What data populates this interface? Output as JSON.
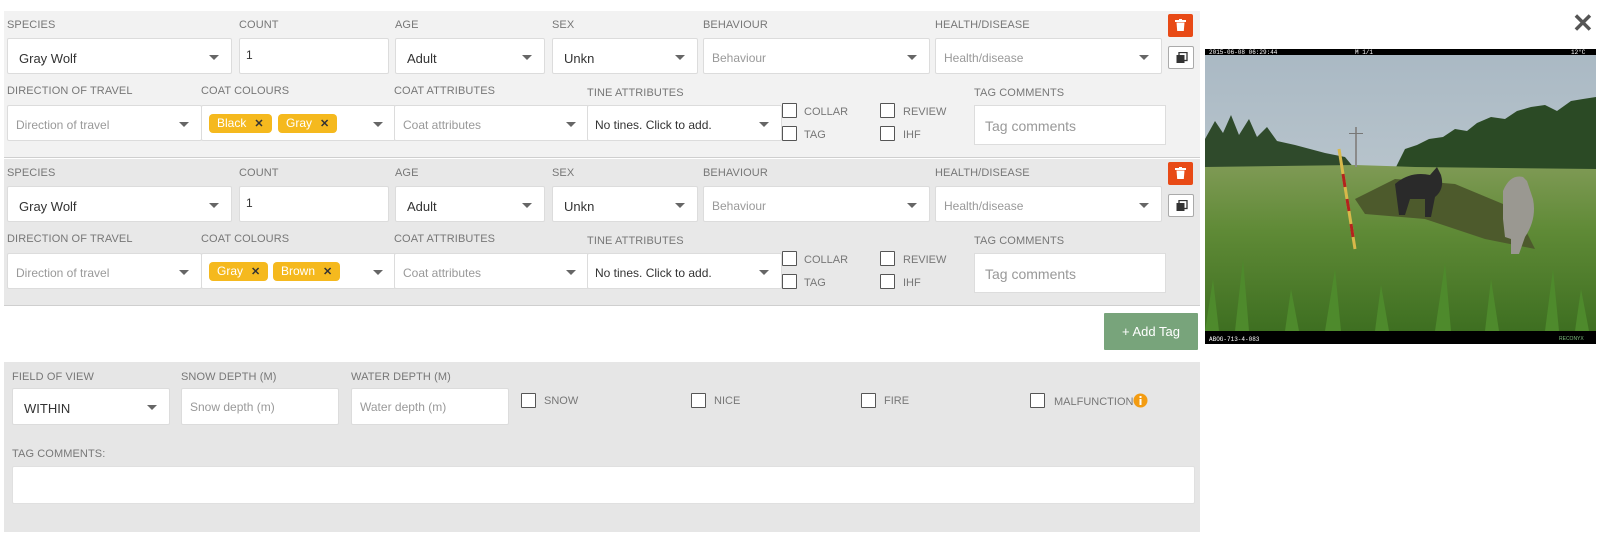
{
  "labels": {
    "species": "SPECIES",
    "count": "COUNT",
    "age": "AGE",
    "sex": "SEX",
    "behaviour": "BEHAVIOUR",
    "health": "HEALTH/DISEASE",
    "direction": "DIRECTION OF TRAVEL",
    "coat_colours": "COAT COLOURS",
    "coat_attributes": "COAT ATTRIBUTES",
    "tine_attributes": "TINE ATTRIBUTES",
    "tag_comments": "TAG COMMENTS",
    "collar": "COLLAR",
    "tag": "TAG",
    "review": "REVIEW",
    "ihf": "IHF"
  },
  "placeholders": {
    "behaviour": "Behaviour",
    "health": "Health/disease",
    "direction": "Direction of travel",
    "coat_attributes": "Coat attributes",
    "tine": "No tines. Click to add.",
    "tag_comments": "Tag comments"
  },
  "tags": [
    {
      "species": "Gray Wolf",
      "count": "1",
      "age": "Adult",
      "sex": "Unkn",
      "coat_colours": [
        "Black",
        "Gray"
      ]
    },
    {
      "species": "Gray Wolf",
      "count": "1",
      "age": "Adult",
      "sex": "Unkn",
      "coat_colours": [
        "Gray",
        "Brown"
      ]
    }
  ],
  "add_tag_label": "+ Add Tag",
  "image_meta": {
    "field_of_view_label": "FIELD OF VIEW",
    "field_of_view_value": "WITHIN",
    "snow_depth_label": "SNOW DEPTH (M)",
    "snow_depth_placeholder": "Snow depth (m)",
    "water_depth_label": "WATER DEPTH (M)",
    "water_depth_placeholder": "Water depth (m)",
    "snow": "SNOW",
    "nice": "NICE",
    "fire": "FIRE",
    "malfunction": "MALFUNCTION",
    "tag_comments_label": "TAG COMMENTS:"
  },
  "photo": {
    "timestamp": "2015-06-08 06:29:44",
    "temp": "M 1/1",
    "moon": "12°C",
    "camera_id": "ABOG-713-4-083",
    "brand": "RECONYX"
  },
  "close_glyph": "✕",
  "colors": {
    "delete": "#e84a16",
    "chip": "#f5b91e",
    "add_tag": "#78a47b",
    "info": "#f39c12"
  }
}
